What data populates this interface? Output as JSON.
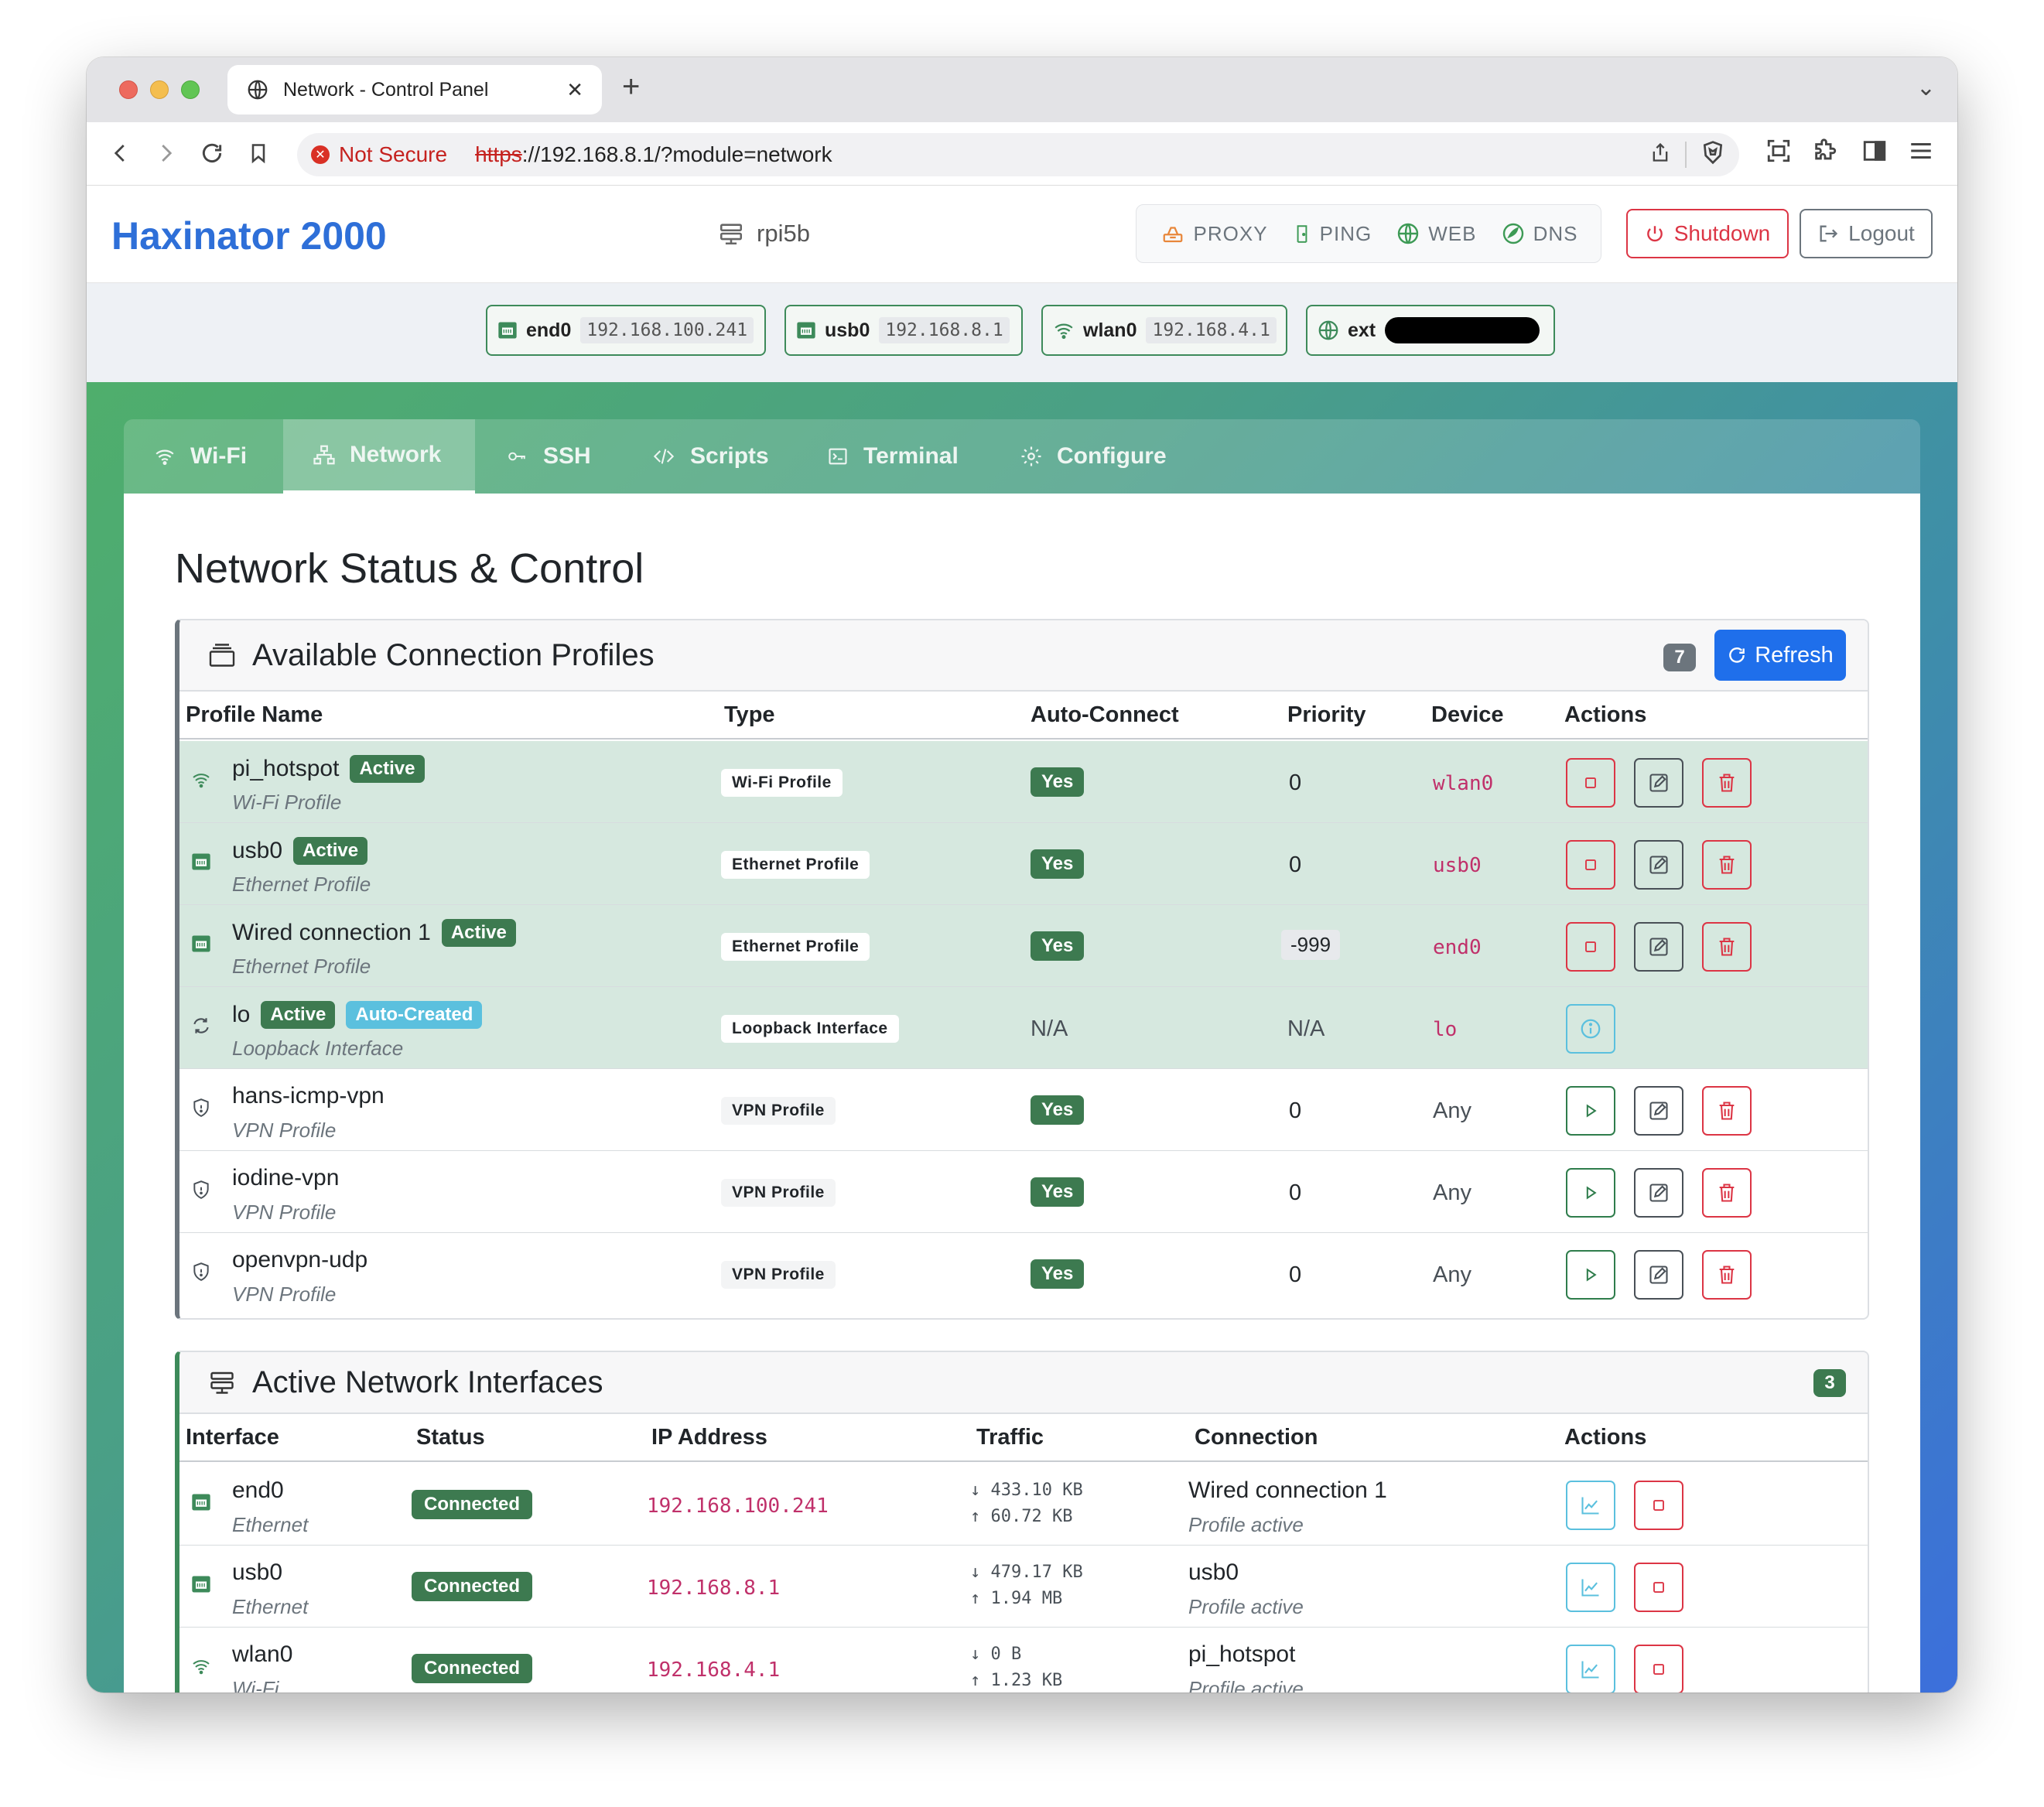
{
  "browser": {
    "tab_title": "Network - Control Panel",
    "new_tab": "+",
    "security_label": "Not Secure",
    "url_scheme": "https",
    "url_rest": "://192.168.8.1/?module=network"
  },
  "app": {
    "brand": "Haxinator 2000",
    "hostname": "rpi5b",
    "services": [
      {
        "label": "PROXY",
        "icon": "proxy-icon",
        "color": "#e8873a"
      },
      {
        "label": "PING",
        "icon": "ping-icon",
        "color": "#3d9a55"
      },
      {
        "label": "WEB",
        "icon": "globe-icon",
        "color": "#3d9a55"
      },
      {
        "label": "DNS",
        "icon": "dns-icon",
        "color": "#3d9a55"
      }
    ],
    "shutdown_label": "Shutdown",
    "logout_label": "Logout"
  },
  "interfaces_bar": [
    {
      "name": "end0",
      "ip": "192.168.100.241",
      "icon": "ethernet-icon"
    },
    {
      "name": "usb0",
      "ip": "192.168.8.1",
      "icon": "ethernet-icon"
    },
    {
      "name": "wlan0",
      "ip": "192.168.4.1",
      "icon": "wifi-icon"
    },
    {
      "name": "ext",
      "ip": "",
      "icon": "globe-icon"
    }
  ],
  "nav_tabs": [
    {
      "label": "Wi-Fi",
      "icon": "wifi-icon",
      "active": false
    },
    {
      "label": "Network",
      "icon": "network-icon",
      "active": true
    },
    {
      "label": "SSH",
      "icon": "key-icon",
      "active": false
    },
    {
      "label": "Scripts",
      "icon": "code-icon",
      "active": false
    },
    {
      "label": "Terminal",
      "icon": "terminal-icon",
      "active": false
    },
    {
      "label": "Configure",
      "icon": "gear-icon",
      "active": false
    }
  ],
  "page_title": "Network Status & Control",
  "profiles": {
    "title": "Available Connection Profiles",
    "count": "7",
    "refresh_label": "Refresh",
    "columns": [
      "Profile Name",
      "Type",
      "Auto-Connect",
      "Priority",
      "Device",
      "Actions"
    ],
    "rows": [
      {
        "name": "pi_hotspot",
        "badges": [
          "Active"
        ],
        "subtitle": "Wi-Fi Profile",
        "type": "Wi-Fi Profile",
        "auto": "Yes",
        "priority": "0",
        "device": "wlan0",
        "active": true
      },
      {
        "name": "usb0",
        "badges": [
          "Active"
        ],
        "subtitle": "Ethernet Profile",
        "type": "Ethernet Profile",
        "auto": "Yes",
        "priority": "0",
        "device": "usb0",
        "active": true
      },
      {
        "name": "Wired connection 1",
        "badges": [
          "Active"
        ],
        "subtitle": "Ethernet Profile",
        "type": "Ethernet Profile",
        "auto": "Yes",
        "priority": "-999",
        "device": "end0",
        "active": true
      },
      {
        "name": "lo",
        "badges": [
          "Active",
          "Auto-Created"
        ],
        "subtitle": "Loopback Interface",
        "type": "Loopback Interface",
        "auto": "N/A",
        "priority": "N/A",
        "device": "lo",
        "active": true
      },
      {
        "name": "hans-icmp-vpn",
        "badges": [],
        "subtitle": "VPN Profile",
        "type": "VPN Profile",
        "auto": "Yes",
        "priority": "0",
        "device": "Any",
        "active": false
      },
      {
        "name": "iodine-vpn",
        "badges": [],
        "subtitle": "VPN Profile",
        "type": "VPN Profile",
        "auto": "Yes",
        "priority": "0",
        "device": "Any",
        "active": false
      },
      {
        "name": "openvpn-udp",
        "badges": [],
        "subtitle": "VPN Profile",
        "type": "VPN Profile",
        "auto": "Yes",
        "priority": "0",
        "device": "Any",
        "active": false
      }
    ]
  },
  "interfaces": {
    "title": "Active Network Interfaces",
    "count": "3",
    "columns": [
      "Interface",
      "Status",
      "IP Address",
      "Traffic",
      "Connection",
      "Actions"
    ],
    "rows": [
      {
        "name": "end0",
        "subtitle": "Ethernet",
        "status": "Connected",
        "ip": "192.168.100.241",
        "rx": "↓ 433.10 KB",
        "tx": "↑ 60.72 KB",
        "connection": "Wired connection 1",
        "connection_sub": "Profile active"
      },
      {
        "name": "usb0",
        "subtitle": "Ethernet",
        "status": "Connected",
        "ip": "192.168.8.1",
        "rx": "↓ 479.17 KB",
        "tx": "↑ 1.94 MB",
        "connection": "usb0",
        "connection_sub": "Profile active"
      },
      {
        "name": "wlan0",
        "subtitle": "Wi-Fi",
        "status": "Connected",
        "ip": "192.168.4.1",
        "rx": "↓ 0 B",
        "tx": "↑ 1.23 KB",
        "connection": "pi_hotspot",
        "connection_sub": "Profile active"
      }
    ]
  }
}
